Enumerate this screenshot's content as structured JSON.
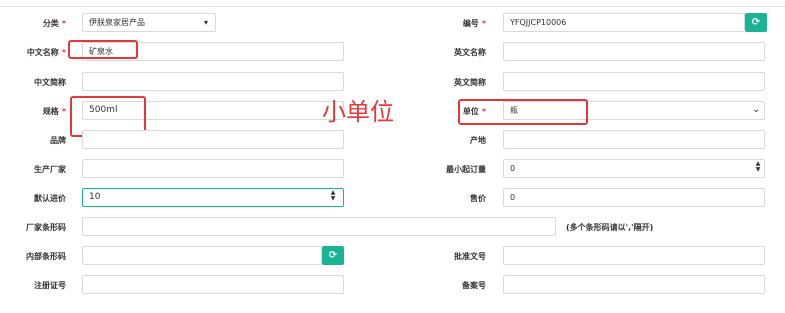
{
  "rows": {
    "category": {
      "label": "分类",
      "value": "伊朕泉家居产品"
    },
    "code": {
      "label": "编号",
      "value": "YFQJJCP10006"
    },
    "cn_name": {
      "label": "中文名称",
      "value": "矿泉水"
    },
    "en_name": {
      "label": "英文名称",
      "value": ""
    },
    "cn_short": {
      "label": "中文简称",
      "value": ""
    },
    "en_short": {
      "label": "英文简称",
      "value": ""
    },
    "spec": {
      "label": "规格",
      "value": "500ml"
    },
    "unit": {
      "label": "单位",
      "value": "瓶"
    },
    "brand": {
      "label": "品牌",
      "value": ""
    },
    "origin": {
      "label": "产地",
      "value": ""
    },
    "manufacturer": {
      "label": "生产厂家",
      "value": ""
    },
    "min_order": {
      "label": "最小起订量",
      "value": "0"
    },
    "default_price": {
      "label": "默认进价",
      "value": "10"
    },
    "sale_price": {
      "label": "售价",
      "value": "0"
    },
    "vendor_barcode": {
      "label": "厂家条形码",
      "value": "",
      "hint": "(多个条形码请以','隔开)"
    },
    "internal_barcode": {
      "label": "内部条形码",
      "value": ""
    },
    "approval_no": {
      "label": "批准文号",
      "value": ""
    },
    "reg_cert": {
      "label": "注册证号",
      "value": ""
    },
    "record_no": {
      "label": "备案号",
      "value": ""
    }
  },
  "annotation": {
    "text": "小单位"
  },
  "icons": {
    "refresh": "refresh-icon",
    "chevron": "chevron-down-icon",
    "stepper": "stepper-icon"
  }
}
